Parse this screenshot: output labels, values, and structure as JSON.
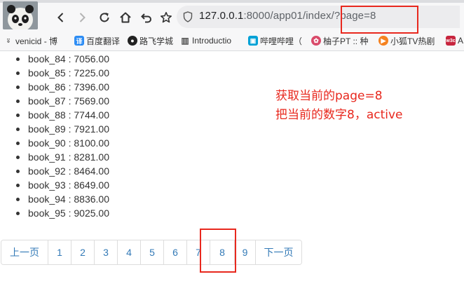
{
  "browser": {
    "url_host": "127.0.0.1",
    "url_path": ":8000/app01/index/?page=8",
    "bookmarks": [
      {
        "label": "venicid - 博",
        "icon": "venicid-icon",
        "color": "#555555"
      },
      {
        "label": "百度翻译",
        "icon": "baidu-translate-icon",
        "color": "#2c8cf4"
      },
      {
        "label": "路飞学城",
        "icon": "luffy-icon",
        "color": "#222222"
      },
      {
        "label": "Introductio",
        "icon": "book-icon",
        "color": "#555555"
      },
      {
        "label": "哔哩哔哩（",
        "icon": "bilibili-icon",
        "color": "#00a1d6"
      },
      {
        "label": "柚子PT :: 种",
        "icon": "pt-icon",
        "color": "#d94a6a"
      },
      {
        "label": "小狐TV热剧",
        "icon": "play-icon",
        "color": "#f58220"
      },
      {
        "label": "A",
        "icon": "w3c-icon",
        "color": "#c7253e"
      }
    ]
  },
  "books": [
    {
      "label": "book_84 : 7056.00"
    },
    {
      "label": "book_85 : 7225.00"
    },
    {
      "label": "book_86 : 7396.00"
    },
    {
      "label": "book_87 : 7569.00"
    },
    {
      "label": "book_88 : 7744.00"
    },
    {
      "label": "book_89 : 7921.00"
    },
    {
      "label": "book_90 : 8100.00"
    },
    {
      "label": "book_91 : 8281.00"
    },
    {
      "label": "book_92 : 8464.00"
    },
    {
      "label": "book_93 : 8649.00"
    },
    {
      "label": "book_94 : 8836.00"
    },
    {
      "label": "book_95 : 9025.00"
    }
  ],
  "annotation": {
    "line1": "获取当前的page=8",
    "line2": "把当前的数字8，active"
  },
  "pagination": {
    "prev_label": "上一页",
    "pages": [
      "1",
      "2",
      "3",
      "4",
      "5",
      "6",
      "7",
      "8",
      "9"
    ],
    "current": "8",
    "next_label": "下一页"
  },
  "colors": {
    "link": "#337ab7",
    "annotation_red": "#e8281e",
    "border": "#dddddd"
  }
}
